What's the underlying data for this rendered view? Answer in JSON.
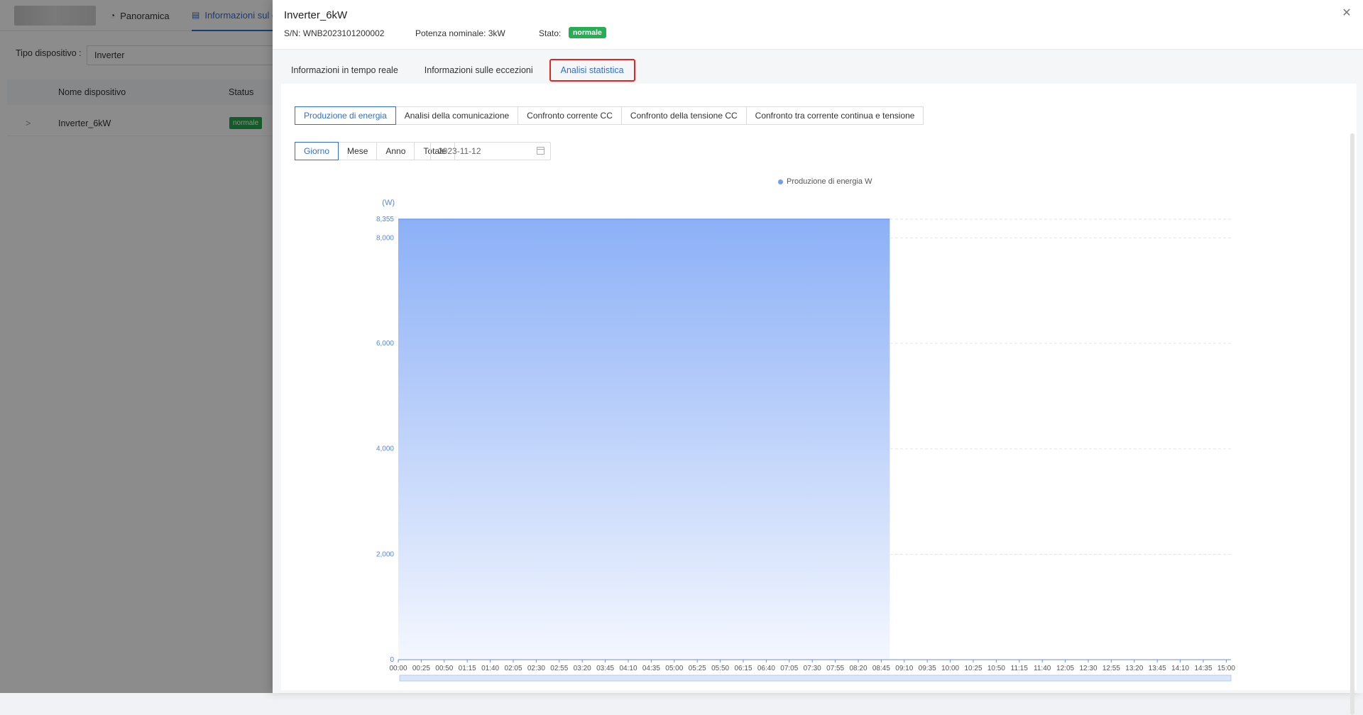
{
  "background": {
    "nav": [
      {
        "icon": "dashboard-icon",
        "label": "Panoramica"
      },
      {
        "icon": "document-icon",
        "label": "Informazioni sul d"
      }
    ],
    "filter_label": "Tipo dispositivo :",
    "filter_value": "Inverter",
    "table_headers": [
      "Nome dispositivo",
      "Status"
    ],
    "row": {
      "expand": ">",
      "name": "Inverter_6kW",
      "status": "normale"
    }
  },
  "drawer": {
    "title": "Inverter_6kW",
    "sn_label": "S/N:",
    "sn_value": "WNB2023101200002",
    "power_label": "Potenza nominale:",
    "power_value": "3kW",
    "state_label": "Stato:",
    "state_value": "normale",
    "close_icon": "close-icon",
    "tabs": [
      "Informazioni in tempo reale",
      "Informazioni sulle eccezioni",
      "Analisi statistica"
    ],
    "active_tab": 2,
    "subtabs": [
      "Produzione di energia",
      "Analisi della comunicazione",
      "Confronto corrente CC",
      "Confronto della tensione CC",
      "Confronto tra corrente continua e tensione"
    ],
    "active_subtab": 0,
    "periods": [
      "Giorno",
      "Mese",
      "Anno",
      "Totale"
    ],
    "active_period": 0,
    "date": "2023-11-12"
  },
  "chart_data": {
    "type": "area",
    "legend": "Produzione di energia W",
    "ylabel": "(W)",
    "yticks": [
      "0",
      "2,000",
      "4,000",
      "6,000",
      "8,000",
      "8,355"
    ],
    "ytick_values": [
      0,
      2000,
      4000,
      6000,
      8000,
      8355
    ],
    "ylim": [
      0,
      8355
    ],
    "x": [
      "00:00",
      "00:25",
      "00:50",
      "01:15",
      "01:40",
      "02:05",
      "02:30",
      "02:55",
      "03:20",
      "03:45",
      "04:10",
      "04:35",
      "05:00",
      "05:25",
      "05:50",
      "06:15",
      "06:40",
      "07:05",
      "07:30",
      "07:55",
      "08:20",
      "08:45",
      "09:10",
      "09:35",
      "10:00",
      "10:25",
      "10:50",
      "11:15",
      "11:40",
      "12:05",
      "12:30",
      "12:55",
      "13:20",
      "13:45",
      "14:10",
      "14:35",
      "15:00"
    ],
    "series": [
      {
        "name": "Produzione di energia W",
        "x_start": "00:00",
        "x_end": "08:45",
        "value": 8355
      }
    ],
    "color": "#6f9ef5"
  }
}
